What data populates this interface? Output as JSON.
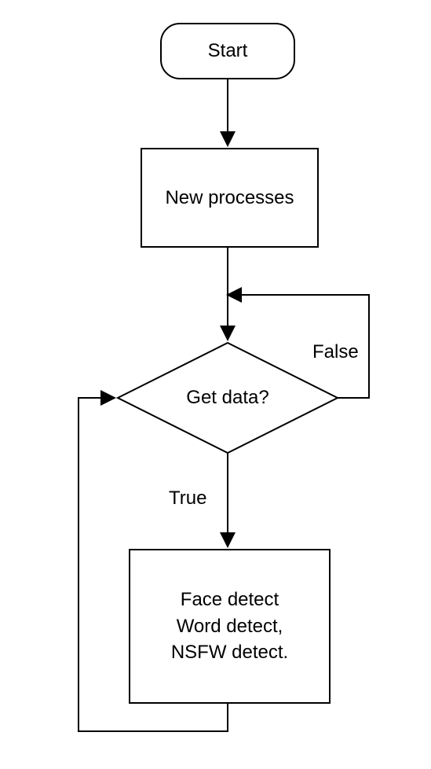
{
  "flowchart": {
    "nodes": {
      "start": {
        "label": "Start",
        "type": "terminal"
      },
      "new_processes": {
        "label": "New processes",
        "type": "process"
      },
      "get_data": {
        "label": "Get data?",
        "type": "decision"
      },
      "detect": {
        "label": "Face detect\nWord detect,\nNSFW detect.",
        "type": "process"
      }
    },
    "edges": {
      "start_to_new": {
        "from": "start",
        "to": "new_processes"
      },
      "new_to_getdata": {
        "from": "new_processes",
        "to": "get_data"
      },
      "getdata_true": {
        "from": "get_data",
        "to": "detect",
        "label": "True"
      },
      "getdata_false": {
        "from": "get_data",
        "to": "get_data",
        "label": "False"
      },
      "detect_loop": {
        "from": "detect",
        "to": "get_data"
      }
    }
  }
}
